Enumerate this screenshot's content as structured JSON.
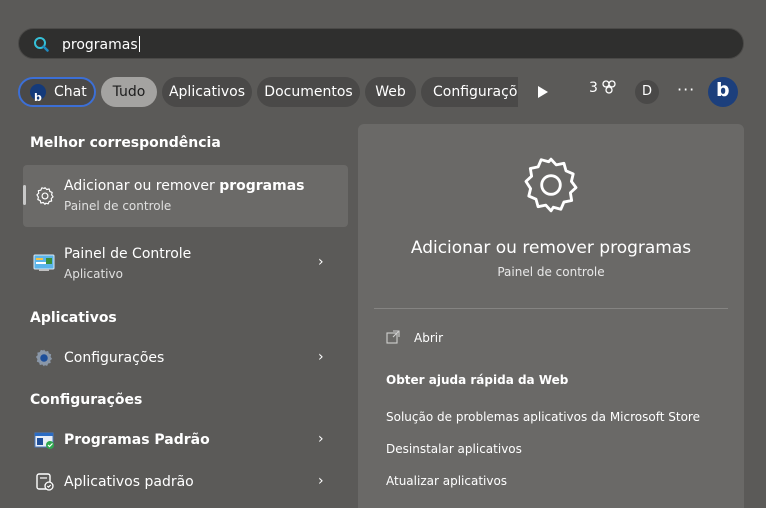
{
  "search": {
    "query": "programas"
  },
  "filters": [
    {
      "label": "Chat"
    },
    {
      "label": "Tudo"
    },
    {
      "label": "Aplicativos"
    },
    {
      "label": "Documentos"
    },
    {
      "label": "Web"
    },
    {
      "label": "Configurações"
    }
  ],
  "toolbar": {
    "rewards_count": "3",
    "account_initial": "D",
    "more": "···"
  },
  "sections": {
    "best_match": "Melhor correspondência",
    "apps": "Aplicativos",
    "settings": "Configurações"
  },
  "best_match": {
    "title_prefix": "Adicionar ou remover ",
    "title_bold": "programas",
    "subtitle": "Painel de controle"
  },
  "results": {
    "control_panel": {
      "title": "Painel de Controle",
      "subtitle": "Aplicativo"
    },
    "configuracoes": {
      "title": "Configurações"
    },
    "programas_padrao": {
      "title": "Programas Padrão"
    },
    "aplicativos_padrao": {
      "title": "Aplicativos padrão"
    }
  },
  "preview": {
    "title": "Adicionar ou remover programas",
    "subtitle": "Painel de controle",
    "actions": [
      "Abrir",
      "Obter ajuda rápida da Web",
      "Solução de problemas aplicativos da Microsoft Store",
      "Desinstalar aplicativos",
      "Atualizar aplicativos"
    ]
  },
  "chevron": "›",
  "bing_letter": "b"
}
